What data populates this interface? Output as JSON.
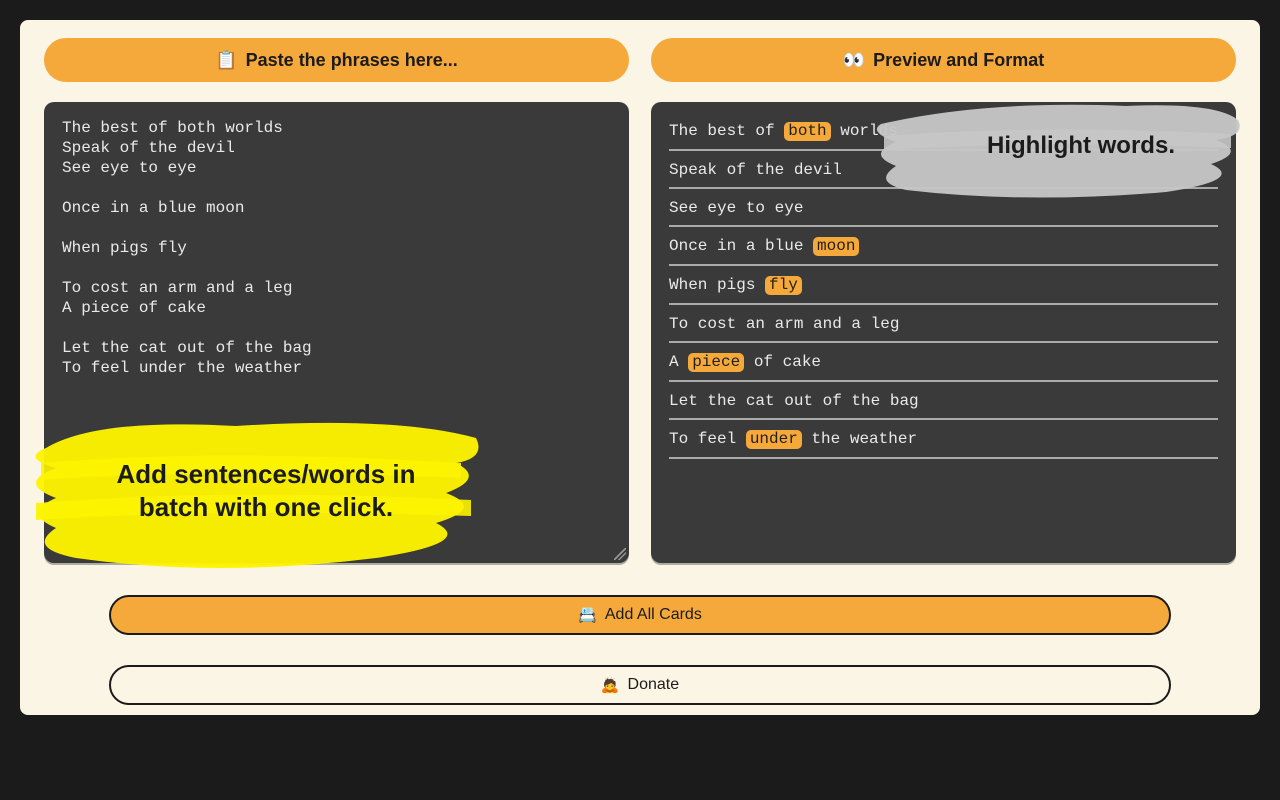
{
  "headers": {
    "left_icon": "📋",
    "left_label": "Paste the phrases here...",
    "right_icon": "👀",
    "right_label": "Preview and Format"
  },
  "input_text": "The best of both worlds\nSpeak of the devil\nSee eye to eye\n\nOnce in a blue moon\n\nWhen pigs fly\n\nTo cost an arm and a leg\nA piece of cake\n\nLet the cat out of the bag\nTo feel under the weather",
  "preview": [
    {
      "parts": [
        {
          "t": "The best of "
        },
        {
          "t": "both",
          "hl": true
        },
        {
          "t": " worlds"
        }
      ]
    },
    {
      "parts": [
        {
          "t": "Speak of the devil"
        }
      ]
    },
    {
      "parts": [
        {
          "t": "See eye to eye"
        }
      ]
    },
    {
      "parts": [
        {
          "t": "Once in a blue "
        },
        {
          "t": "moon",
          "hl": true
        }
      ]
    },
    {
      "parts": [
        {
          "t": "When pigs "
        },
        {
          "t": "fly",
          "hl": true
        }
      ]
    },
    {
      "parts": [
        {
          "t": "To cost an arm and a leg"
        }
      ]
    },
    {
      "parts": [
        {
          "t": "A "
        },
        {
          "t": "piece",
          "hl": true
        },
        {
          "t": " of cake"
        }
      ]
    },
    {
      "parts": [
        {
          "t": "Let the cat out of the bag"
        }
      ]
    },
    {
      "parts": [
        {
          "t": "To feel "
        },
        {
          "t": "under",
          "hl": true
        },
        {
          "t": " the weather"
        }
      ]
    }
  ],
  "callouts": {
    "yellow": "Add sentences/words in batch with one click.",
    "grey": "Highlight words."
  },
  "buttons": {
    "add_icon": "📇",
    "add_label": "Add All Cards",
    "donate_icon": "🙇",
    "donate_label": "Donate"
  },
  "colors": {
    "accent": "#f6a93b",
    "panel": "#3a3a3a",
    "card": "#faf5e4",
    "bg": "#1b1b1b"
  }
}
